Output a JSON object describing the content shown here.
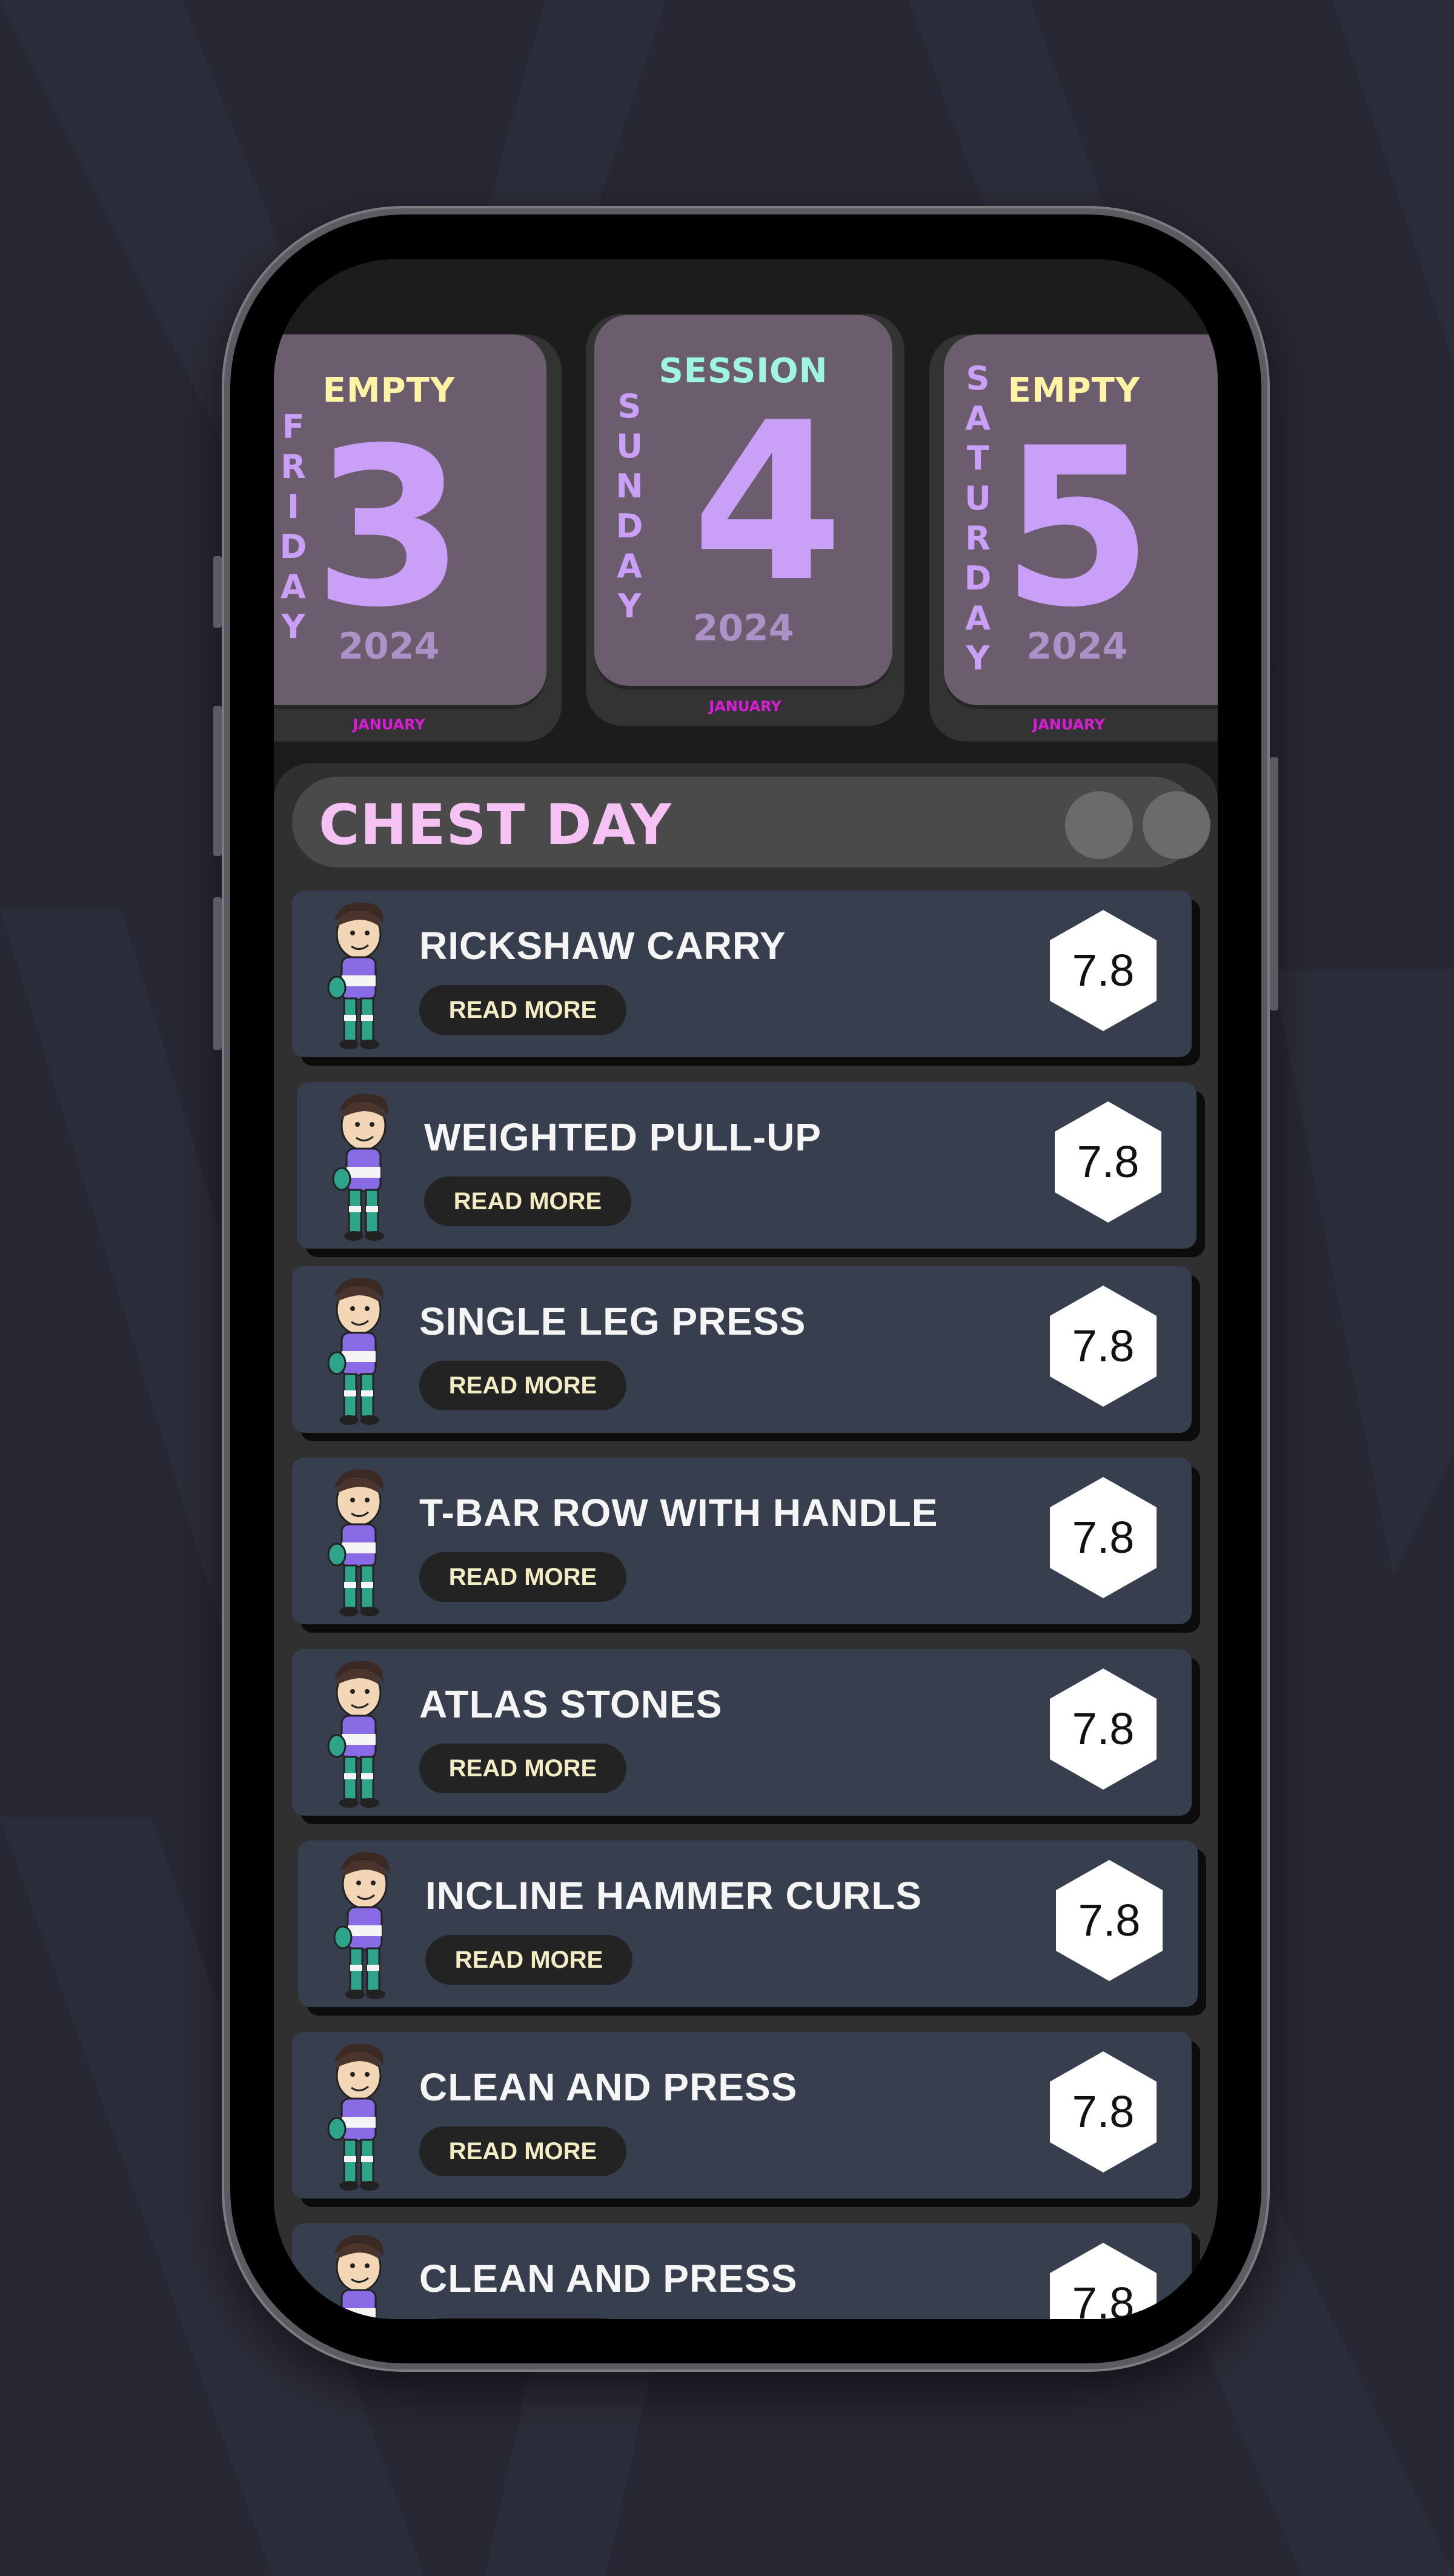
{
  "dates": [
    {
      "status": "EMPTY",
      "day": "3",
      "weekday": "FRIDAY",
      "year": "2024",
      "month": "JANUARY"
    },
    {
      "status": "SESSION",
      "day": "4",
      "weekday": "SUNDAY",
      "year": "2024",
      "month": "JANUARY"
    },
    {
      "status": "EMPTY",
      "day": "5",
      "weekday": "SATURDAY",
      "year": "2024",
      "month": "JANUARY"
    }
  ],
  "colors": {
    "empty_status": "#fff3a5",
    "session_status": "#9ff5e4",
    "title": "#f6c2f4",
    "accent_purple": "#c99ff7"
  },
  "workout": {
    "title": "CHEST DAY",
    "read_more_label": "READ MORE",
    "exercises": [
      {
        "name": "RICKSHAW CARRY",
        "score": "7.8"
      },
      {
        "name": "WEIGHTED PULL-UP",
        "score": "7.8"
      },
      {
        "name": "SINGLE LEG PRESS",
        "score": "7.8"
      },
      {
        "name": "T-BAR ROW WITH HANDLE",
        "score": "7.8"
      },
      {
        "name": "ATLAS STONES",
        "score": "7.8"
      },
      {
        "name": "INCLINE HAMMER CURLS",
        "score": "7.8"
      },
      {
        "name": "CLEAN AND PRESS",
        "score": "7.8"
      },
      {
        "name": "CLEAN AND PRESS",
        "score": "7.8"
      }
    ]
  },
  "icons": {
    "avatar": "cartoon-boy-icon",
    "score_shape": "hexagon-icon"
  }
}
